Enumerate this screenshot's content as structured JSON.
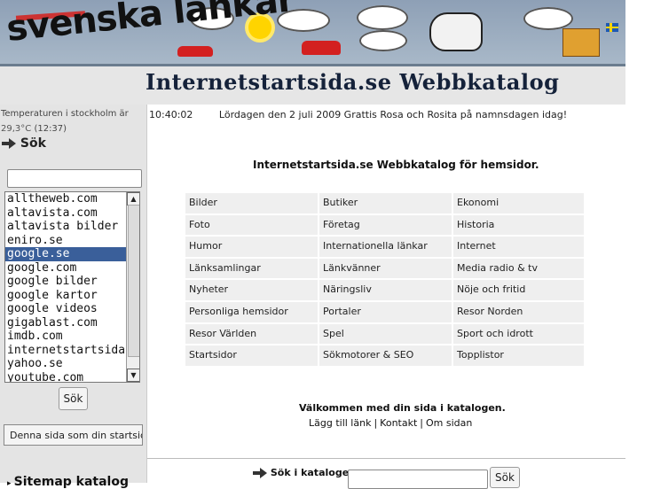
{
  "banner": {
    "logo_text": "svenska länkar",
    "site_title": "Internetstartsida.se Webbkatalog"
  },
  "left": {
    "temp_line1": "Temperaturen i stockholm är",
    "temp_value": "29,3°C",
    "temp_time": "(12:37)",
    "search_heading": "Sök",
    "search_input_value": "",
    "engines": [
      "alltheweb.com",
      "altavista.com",
      "altavista bilder",
      "eniro.se",
      "google.se",
      "google.com",
      "google bilder",
      "google kartor",
      "google videos",
      "gigablast.com",
      "imdb.com",
      "internetstartsida.se",
      "yahoo.se",
      "youtube.com"
    ],
    "selected_engine": "google.se",
    "search_button": "Sök",
    "start_button": "Denna sida som din startsida",
    "sitemap": "Sitemap katalog"
  },
  "main": {
    "time": "10:40:02",
    "date_text": "Lördagen den 2 juli 2009 Grattis Rosa och Rosita på namnsdagen idag!",
    "heading": "Internetstartsida.se Webbkatalog för hemsidor.",
    "categories": [
      "Bilder",
      "Butiker",
      "Ekonomi",
      "Foto",
      "Företag",
      "Historia",
      "Humor",
      "Internationella länkar",
      "Internet",
      "Länksamlingar",
      "Länkvänner",
      "Media radio & tv",
      "Nyheter",
      "Näringsliv",
      "Nöje och fritid",
      "Personliga hemsidor",
      "Portaler",
      "Resor Norden",
      "Resor Världen",
      "Spel",
      "Sport och idrott",
      "Startsidor",
      "Sökmotorer & SEO",
      "Topplistor"
    ],
    "welcome": "Välkommen med din sida i katalogen.",
    "link_add": "Lägg till länk",
    "link_contact": "Kontakt",
    "link_about": "Om sidan",
    "catalog_search_label": "Sök i katalogen:",
    "catalog_search_button": "Sök"
  }
}
